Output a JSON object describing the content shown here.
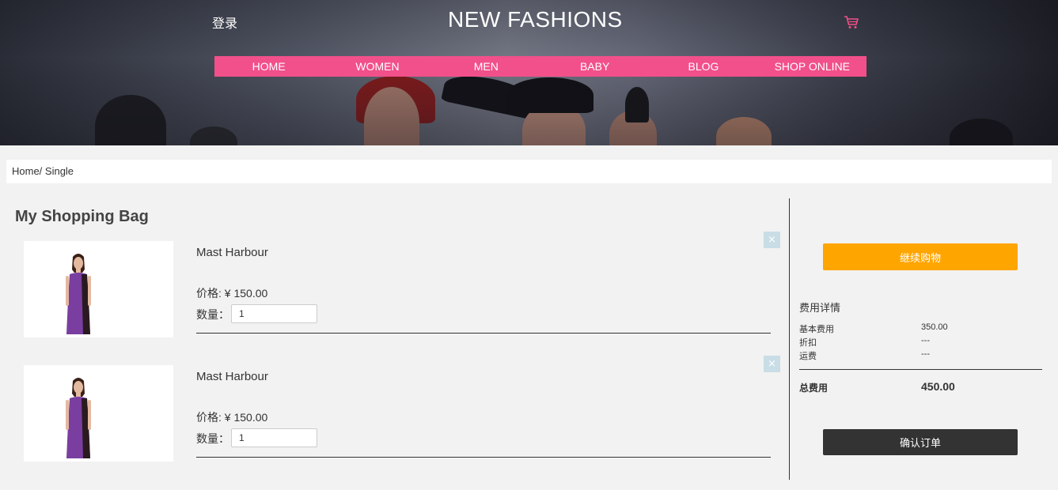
{
  "header": {
    "login_label": "登录",
    "brand": "NEW FASHIONS",
    "cart_icon": "shopping-cart-icon",
    "nav": [
      "HOME",
      "WOMEN",
      "MEN",
      "BABY",
      "BLOG",
      "SHOP ONLINE"
    ]
  },
  "breadcrumb": "Home/ Single",
  "bag": {
    "title": "My Shopping Bag",
    "items": [
      {
        "name": "Mast Harbour",
        "price": "价格: ¥ 150.00",
        "qty_label": "数量：",
        "qty": "1",
        "close": "×"
      },
      {
        "name": "Mast Harbour",
        "price": "价格: ¥ 150.00",
        "qty_label": "数量：",
        "qty": "1",
        "close": "×"
      }
    ]
  },
  "summary": {
    "continue_label": "继续购物",
    "title": "费用详情",
    "rows": [
      {
        "label": "基本费用",
        "value": "350.00"
      },
      {
        "label": "折扣",
        "value": "---"
      },
      {
        "label": "运费",
        "value": "---"
      }
    ],
    "total_label": "总费用",
    "total_value": "450.00",
    "confirm_label": "确认订单"
  },
  "colors": {
    "nav_bg": "#f2508a",
    "continue_bg": "#ffa500",
    "confirm_bg": "#333333",
    "cart_icon": "#f2508a"
  }
}
